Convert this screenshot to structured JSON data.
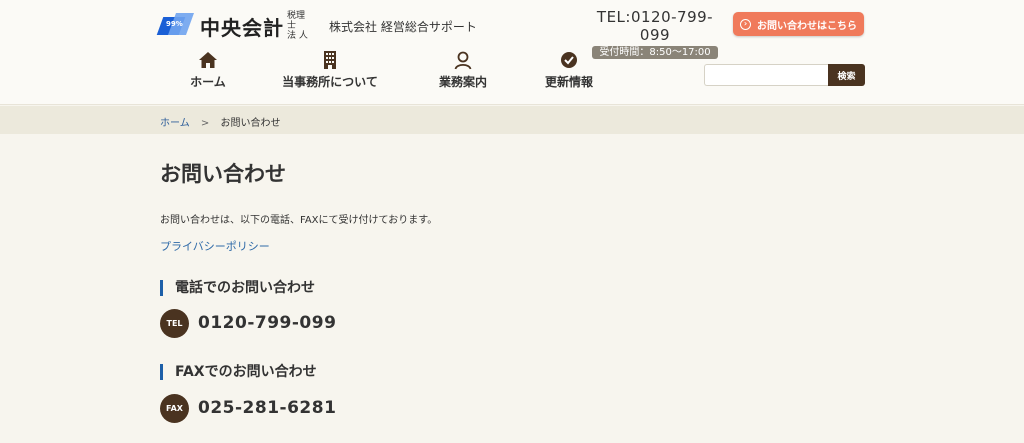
{
  "header": {
    "logo_number": "99%",
    "logo_name": "中央会計",
    "logo_sub1": "税理士",
    "logo_sub2": "法 人",
    "logo_company": "株式会社 経営総合サポート",
    "tel": "TEL:0120-799-099",
    "hours": "受付時間：8:50～17:00",
    "contact_label": "お問い合わせはこちら"
  },
  "nav": {
    "items": [
      {
        "label": "ホーム",
        "icon": "home-icon"
      },
      {
        "label": "当事務所について",
        "icon": "building-icon"
      },
      {
        "label": "業務案内",
        "icon": "person-icon"
      },
      {
        "label": "更新情報",
        "icon": "check-circle-icon"
      }
    ]
  },
  "search": {
    "placeholder": "",
    "button_label": "検索"
  },
  "breadcrumb": {
    "home": "ホーム",
    "separator": ">",
    "current": "お問い合わせ"
  },
  "main": {
    "title": "お問い合わせ",
    "intro": "お問い合わせは、以下の電話、FAXにて受け付けております。",
    "privacy_link": "プライバシーポリシー",
    "phone_heading": "電話でのお問い合わせ",
    "phone_badge": "TEL",
    "phone_number": "0120-799-099",
    "fax_heading": "FAXでのお問い合わせ",
    "fax_badge": "FAX",
    "fax_number": "025-281-6281"
  },
  "colors": {
    "accent_brown": "#4a3320",
    "contact_button": "#f07a5b",
    "heading_bar": "#1d5fa8",
    "link": "#2f6aa8"
  }
}
